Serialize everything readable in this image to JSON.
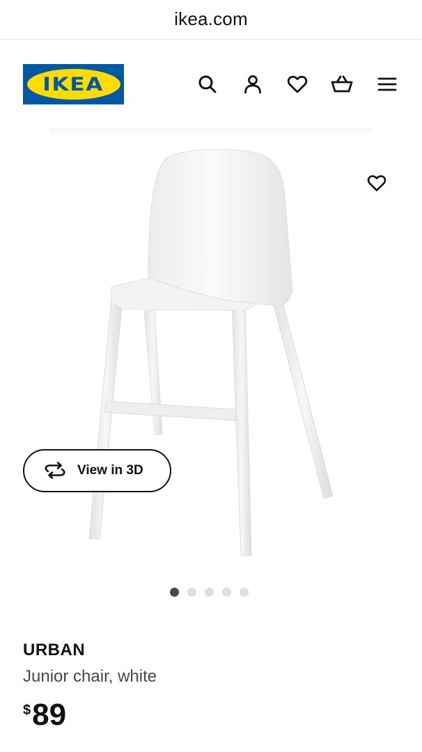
{
  "browser": {
    "url": "ikea.com"
  },
  "header": {
    "logo_text": "IKEA",
    "icons": [
      "search-icon",
      "account-icon",
      "heart-icon",
      "basket-icon",
      "menu-icon"
    ]
  },
  "gallery": {
    "view_3d_label": "View in 3D",
    "image_count": 5,
    "active_index": 0
  },
  "product": {
    "name": "URBAN",
    "description": "Junior chair, white",
    "currency": "$",
    "price": "89"
  },
  "colors": {
    "brand_blue": "#0058A3",
    "brand_yellow": "#FFDB00",
    "active_dot": "#484848",
    "inactive_dot": "#DFDFDF"
  }
}
